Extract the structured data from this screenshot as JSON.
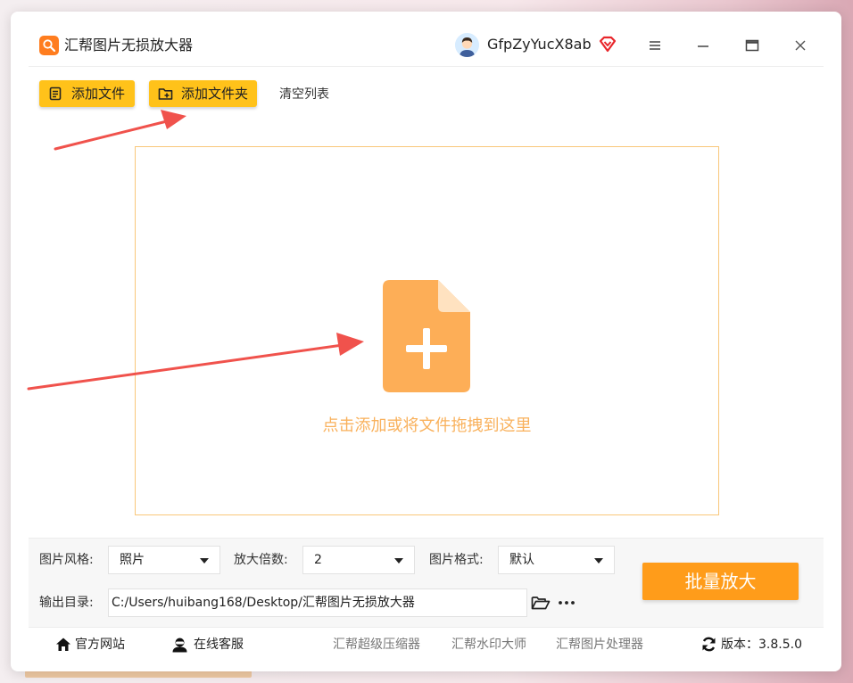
{
  "app": {
    "title": "汇帮图片无损放大器",
    "username": "GfpZyYucX8ab"
  },
  "toolbar": {
    "add_file_label": "添加文件",
    "add_folder_label": "添加文件夹",
    "clear_list_label": "清空列表"
  },
  "dropzone": {
    "hint": "点击添加或将文件拖拽到这里"
  },
  "settings": {
    "style_label": "图片风格:",
    "style_value": "照片",
    "scale_label": "放大倍数:",
    "scale_value": "2",
    "format_label": "图片格式:",
    "format_value": "默认",
    "output_label": "输出目录:",
    "output_path": "C:/Users/huibang168/Desktop/汇帮图片无损放大器",
    "more_label": "···",
    "batch_button": "批量放大"
  },
  "footer": {
    "website": "官方网站",
    "support": "在线客服",
    "link_compress": "汇帮超级压缩器",
    "link_watermark": "汇帮水印大师",
    "link_processor": "汇帮图片处理器",
    "version": "版本：3.8.5.0"
  },
  "colors": {
    "toolbar_button": "#ffc21a",
    "accent_orange": "#ff9c1a",
    "drop_border": "#f9c77a",
    "drop_icon": "#fdae57",
    "arrow_red": "#f0524c"
  },
  "icons": {
    "logo": "magnifier-logo-icon",
    "vip": "diamond-vip-icon",
    "menu": "hamburger-menu-icon",
    "minimize": "minimize-icon",
    "maximize": "maximize-icon",
    "close": "close-icon",
    "add_file": "file-list-icon",
    "add_folder": "folder-plus-icon",
    "drop": "document-plus-icon",
    "output_folder": "folder-open-icon",
    "home": "home-icon",
    "support": "headset-icon",
    "update": "refresh-icon"
  }
}
